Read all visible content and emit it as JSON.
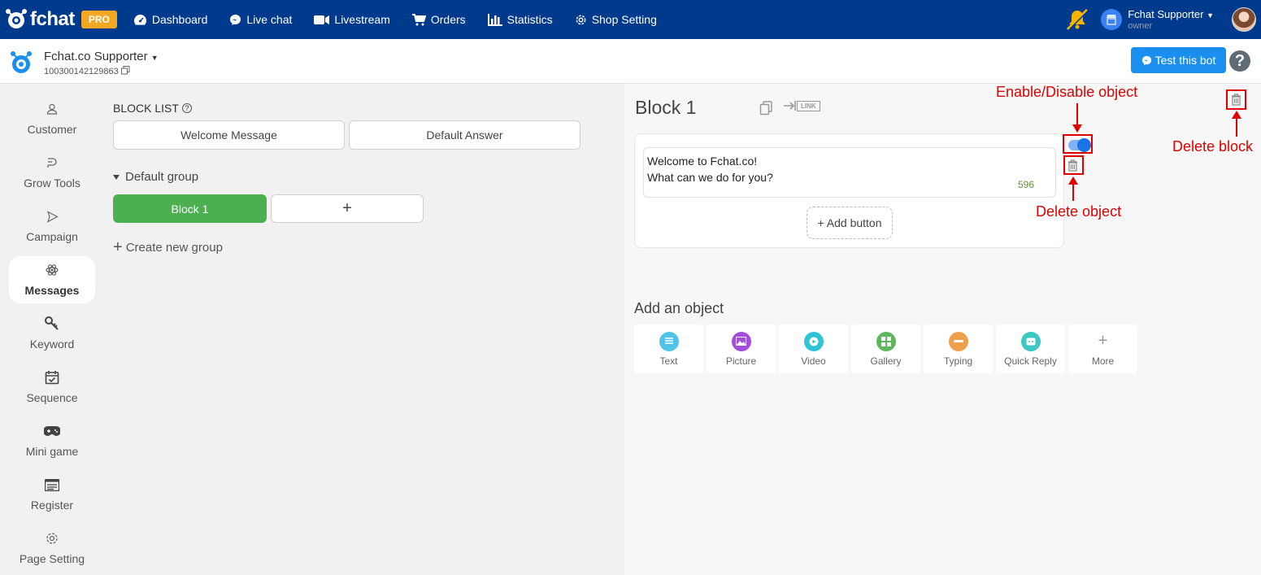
{
  "topnav": {
    "logo_text": "fchat",
    "pro_badge": "PRO",
    "items": [
      {
        "label": "Dashboard",
        "icon": "dashboard-icon"
      },
      {
        "label": "Live chat",
        "icon": "messenger-icon"
      },
      {
        "label": "Livestream",
        "icon": "video-camera-icon"
      },
      {
        "label": "Orders",
        "icon": "cart-icon"
      },
      {
        "label": "Statistics",
        "icon": "bar-chart-icon"
      },
      {
        "label": "Shop Setting",
        "icon": "gear-icon"
      }
    ],
    "user": {
      "name": "Fchat Supporter",
      "role": "owner"
    }
  },
  "subheader": {
    "bot_name": "Fchat.co Supporter",
    "bot_id": "100300142129863",
    "test_button": "Test this bot",
    "help": "?"
  },
  "sidebar": {
    "items": [
      {
        "label": "Customer",
        "icon": "user-icon"
      },
      {
        "label": "Grow Tools",
        "icon": "grow-icon"
      },
      {
        "label": "Campaign",
        "icon": "send-icon"
      },
      {
        "label": "Messages",
        "icon": "atom-icon",
        "active": true
      },
      {
        "label": "Keyword",
        "icon": "key-icon"
      },
      {
        "label": "Sequence",
        "icon": "calendar-check-icon"
      },
      {
        "label": "Mini game",
        "icon": "gamepad-icon"
      },
      {
        "label": "Register",
        "icon": "form-icon"
      },
      {
        "label": "Page Setting",
        "icon": "gear-icon"
      }
    ]
  },
  "blocklist": {
    "title": "BLOCK LIST",
    "fixed_blocks": [
      "Welcome Message",
      "Default Answer"
    ],
    "group_name": "Default group",
    "blocks": [
      "Block 1"
    ],
    "add_block": "+",
    "create_group": "Create new group"
  },
  "editor": {
    "block_title": "Block 1",
    "link_label": "LINK",
    "text_lines": [
      "Welcome to Fchat.co!",
      "What can we do for you?"
    ],
    "char_counter": "596",
    "add_button": "+ Add button",
    "add_object_title": "Add an object",
    "objects": [
      {
        "label": "Text",
        "color": "#4fc3e8"
      },
      {
        "label": "Picture",
        "color": "#a24ddb"
      },
      {
        "label": "Video",
        "color": "#2ec4d6"
      },
      {
        "label": "Gallery",
        "color": "#5cb85c"
      },
      {
        "label": "Typing",
        "color": "#f0a04b"
      },
      {
        "label": "Quick Reply",
        "color": "#3cc7c2"
      },
      {
        "label": "More",
        "color": "#ffffff"
      }
    ]
  },
  "annotations": {
    "enable_disable": "Enable/Disable object",
    "delete_object": "Delete object",
    "delete_block": "Delete block"
  },
  "colors": {
    "nav_bg": "#003a8c",
    "accent_blue": "#1a8ff0",
    "block_green": "#4caf50",
    "annotation_red": "#e00000"
  }
}
